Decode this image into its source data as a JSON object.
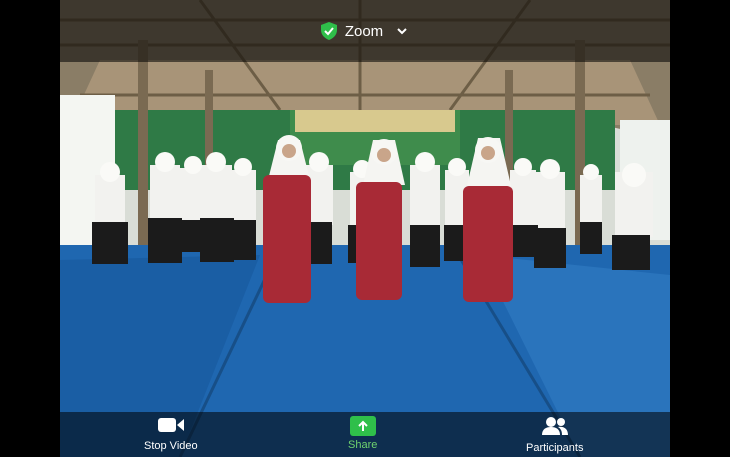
{
  "header": {
    "title": "Zoom"
  },
  "toolbar": {
    "stop_video_label": "Stop Video",
    "share_label": "Share",
    "participants_label": "Participants"
  },
  "icons": {
    "secure": "shield-check-icon",
    "dropdown": "chevron-down-icon",
    "video": "video-camera-icon",
    "share": "share-arrow-icon",
    "participants": "people-icon"
  },
  "colors": {
    "secure_green": "#2fbf4a",
    "share_green": "#2fbf4a",
    "overlay": "rgba(0,0,0,0.55)"
  }
}
